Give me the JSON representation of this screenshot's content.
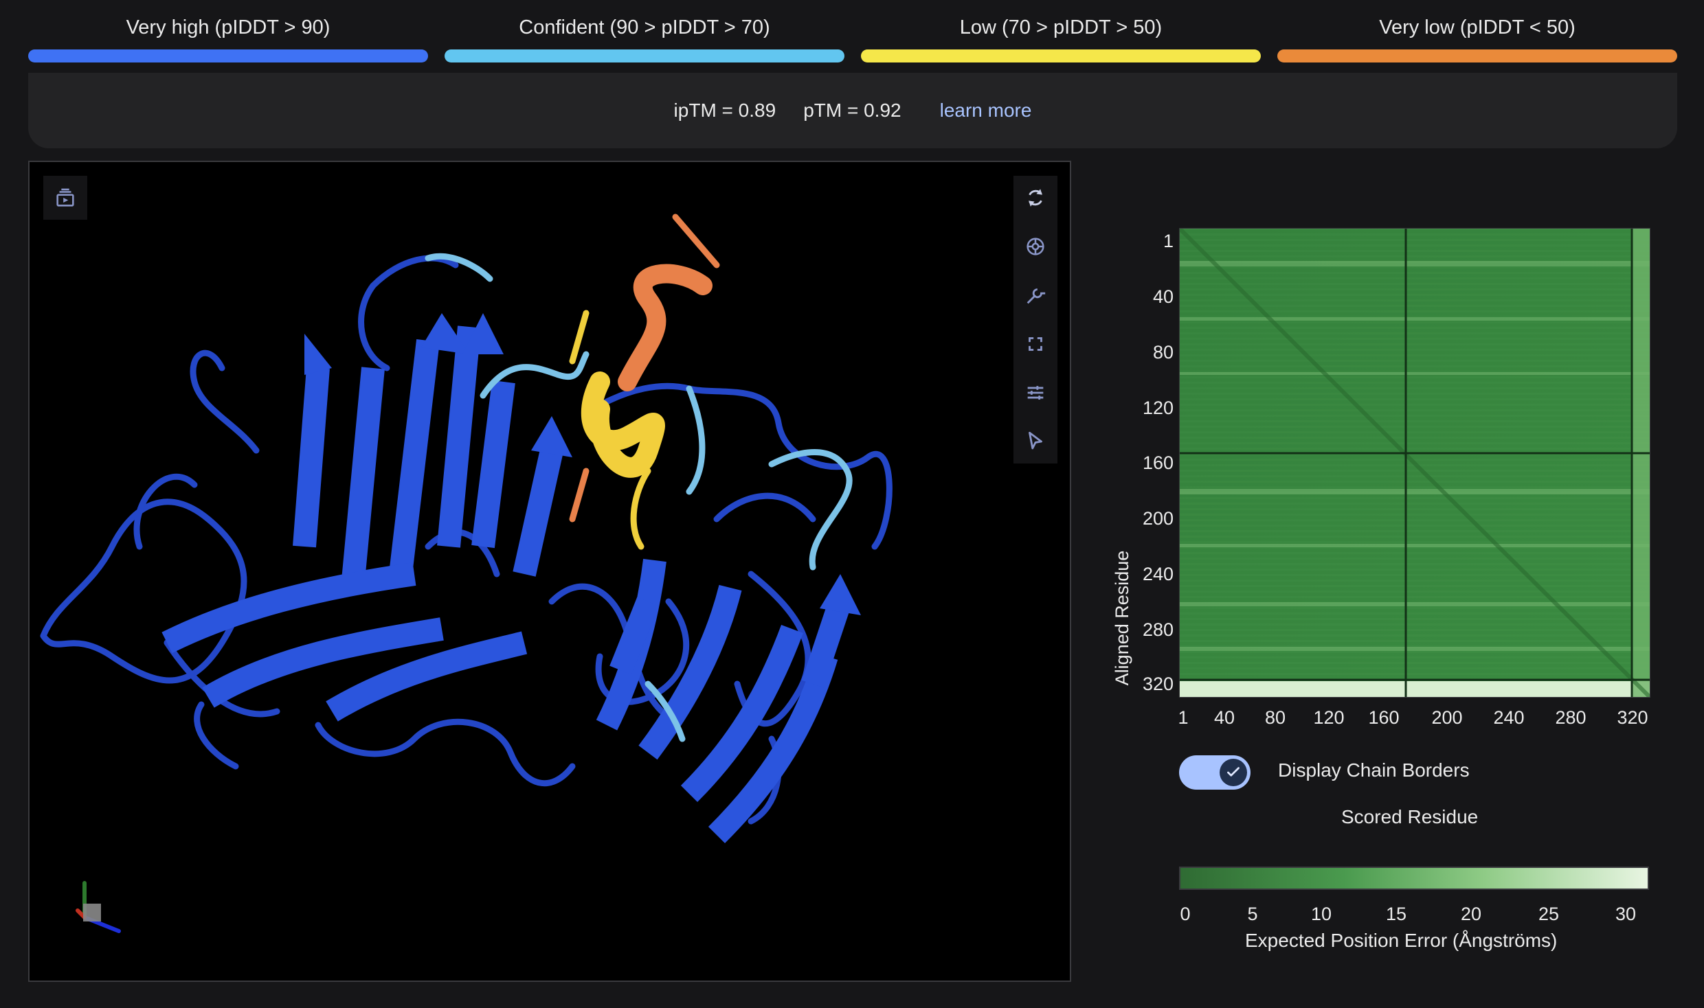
{
  "legend": [
    {
      "label": "Very high (pIDDT > 90)",
      "color": "#3f72f4"
    },
    {
      "label": "Confident (90 > pIDDT > 70)",
      "color": "#62c6f0"
    },
    {
      "label": "Low (70 > pIDDT > 50)",
      "color": "#f5e74a"
    },
    {
      "label": "Very low (pIDDT < 50)",
      "color": "#ea8a3a"
    }
  ],
  "metrics": {
    "iptm": "ipTM = 0.89",
    "ptm": "pTM = 0.92",
    "learn_more": "learn more"
  },
  "viewer": {
    "left_tool_icon": "animation-icon",
    "tools": [
      "reset-rotate-icon",
      "camera-icon",
      "wrench-icon",
      "fullscreen-icon",
      "sliders-icon",
      "select-pointer-icon"
    ]
  },
  "pae": {
    "y_title": "Aligned Residue",
    "x_title": "Scored Residue",
    "y_ticks": [
      "1",
      "40",
      "80",
      "120",
      "160",
      "200",
      "240",
      "280",
      "320"
    ],
    "x_ticks": [
      "1",
      "40",
      "80",
      "120",
      "160",
      "200",
      "240",
      "280",
      "320"
    ],
    "toggle_label": "Display Chain Borders",
    "toggle_on": true,
    "colorbar_ticks": [
      "0",
      "5",
      "10",
      "15",
      "20",
      "25",
      "30"
    ],
    "colorbar_title": "Expected Position Error (Ångströms)"
  }
}
